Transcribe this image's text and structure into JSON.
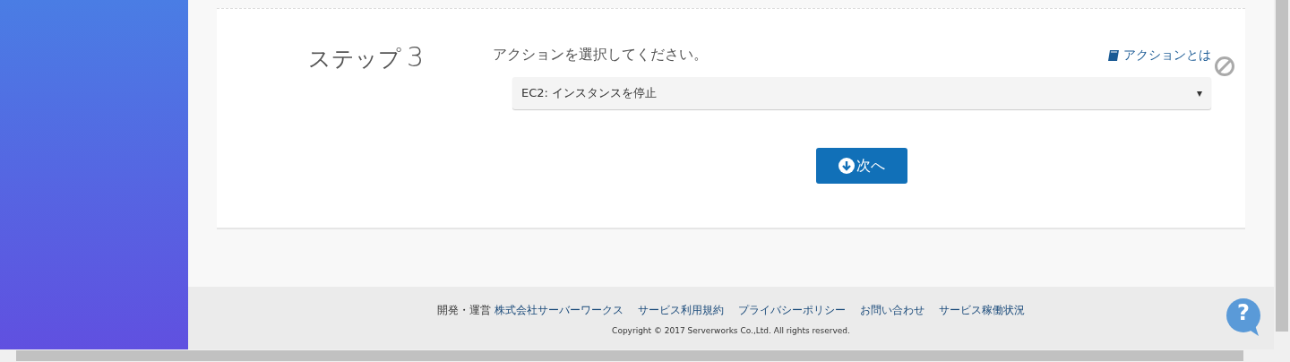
{
  "step": {
    "label": "ステップ",
    "number": "3",
    "prompt": "アクションを選択してください。",
    "help_link": "アクションとは",
    "select": {
      "value": "EC2: インスタンスを停止",
      "caret": "▾"
    },
    "next_button": "次へ"
  },
  "footer": {
    "credit_prefix": "開発・運営",
    "credit_link": "株式会社サーバーワークス",
    "links": [
      "サービス利用規約",
      "プライバシーポリシー",
      "お問い合わせ",
      "サービス稼働状況"
    ],
    "copyright": "Copyright © 2017 Serverworks Co.,Ltd. All rights reserved."
  },
  "help_bubble": "?"
}
